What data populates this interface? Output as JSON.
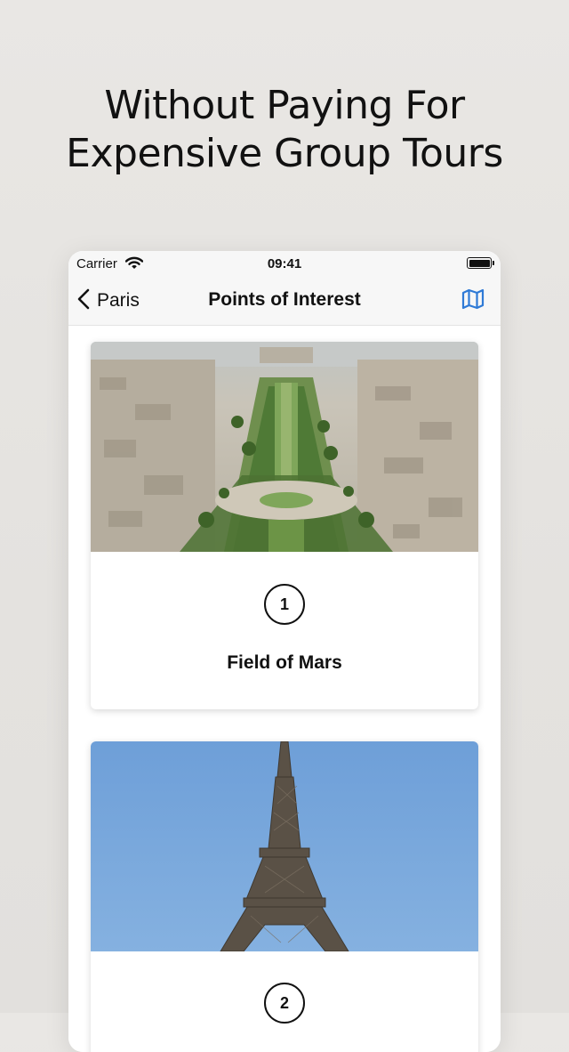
{
  "headline": {
    "line1": "Without Paying For",
    "line2": "Expensive Group Tours"
  },
  "status_bar": {
    "carrier": "Carrier",
    "time": "09:41"
  },
  "nav": {
    "back_label": "Paris",
    "title": "Points of Interest",
    "map_icon": "map-icon",
    "accent_color": "#2f7ad6"
  },
  "cards": [
    {
      "number": "1",
      "title": "Field of Mars",
      "image": "aerial-park-photo"
    },
    {
      "number": "2",
      "title": "",
      "image": "eiffel-tower-photo"
    }
  ]
}
